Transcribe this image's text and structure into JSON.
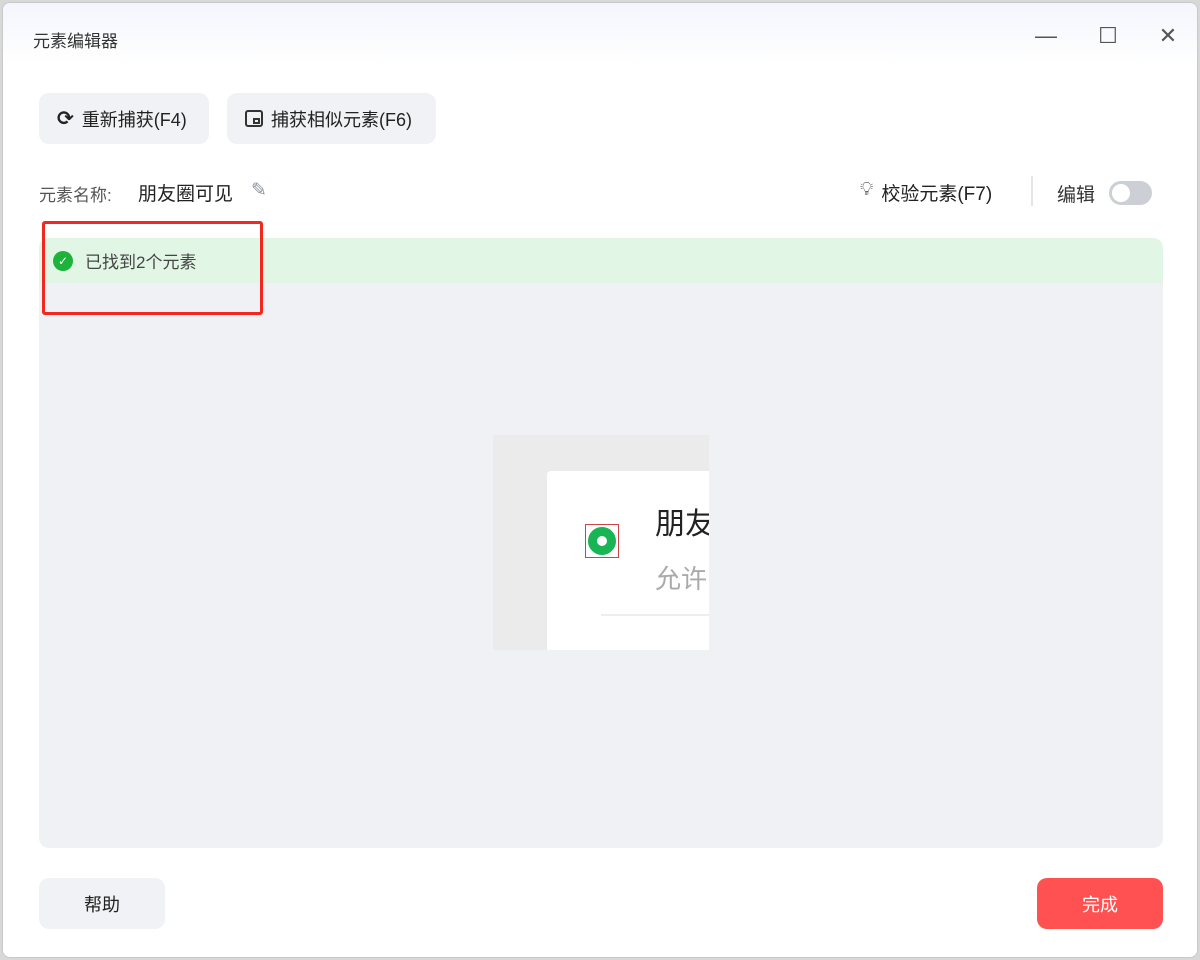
{
  "window": {
    "title": "元素编辑器"
  },
  "toolbar": {
    "recapture": "重新捕获(F4)",
    "capture_similar": "捕获相似元素(F6)"
  },
  "element": {
    "name_label": "元素名称:",
    "name_value": "朋友圈可见"
  },
  "actions": {
    "validate": "校验元素(F7)",
    "edit_label": "编辑",
    "edit_enabled": false
  },
  "status": {
    "found_text": "已找到2个元素"
  },
  "preview": {
    "title_text": "朋友",
    "subtitle_text": "允许"
  },
  "footer": {
    "help": "帮助",
    "done": "完成"
  },
  "colors": {
    "accent": "#ff5151",
    "success": "#1db33b",
    "highlight": "#f2271d"
  }
}
